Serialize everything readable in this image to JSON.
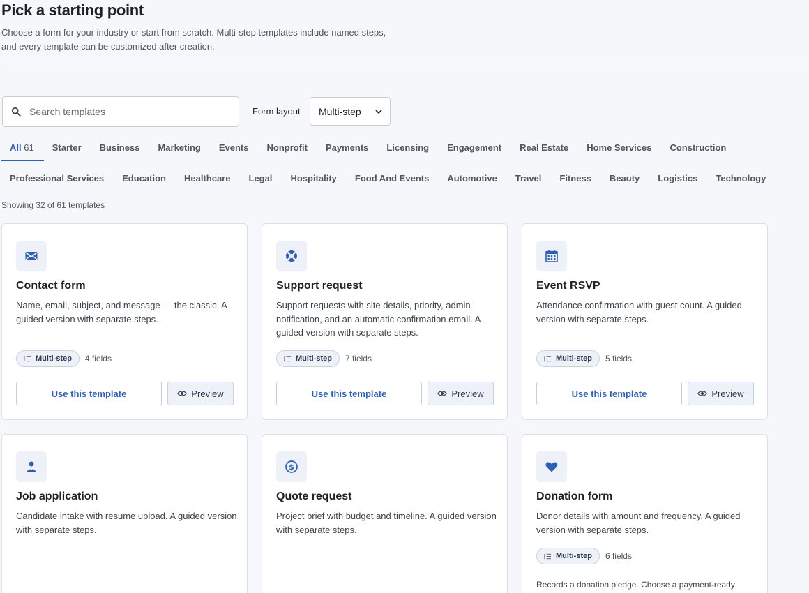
{
  "header": {
    "title": "Pick a starting point",
    "intro_line1": "Choose a form for your industry or start from scratch. Multi-step templates include named steps,",
    "intro_line2": "and every template can be customized after creation."
  },
  "search": {
    "placeholder": "Search templates",
    "value": "",
    "icon": "search-icon"
  },
  "layout": {
    "label": "Form layout",
    "selected": "Multi-step",
    "icon": "chevron-down-icon"
  },
  "tabs_row1": [
    {
      "label": "All",
      "count": "61",
      "active": true
    },
    {
      "label": "Starter"
    },
    {
      "label": "Business"
    },
    {
      "label": "Marketing"
    },
    {
      "label": "Events"
    },
    {
      "label": "Nonprofit"
    },
    {
      "label": "Payments"
    },
    {
      "label": "Licensing"
    },
    {
      "label": "Engagement"
    },
    {
      "label": "Real Estate"
    },
    {
      "label": "Home Services"
    },
    {
      "label": "Construction"
    }
  ],
  "tabs_row2": [
    {
      "label": "Professional Services"
    },
    {
      "label": "Education"
    },
    {
      "label": "Healthcare"
    },
    {
      "label": "Legal"
    },
    {
      "label": "Hospitality"
    },
    {
      "label": "Food And Events"
    },
    {
      "label": "Automotive"
    },
    {
      "label": "Travel"
    },
    {
      "label": "Fitness"
    },
    {
      "label": "Beauty"
    },
    {
      "label": "Logistics"
    },
    {
      "label": "Technology"
    }
  ],
  "showing": "Showing 32 of 61 templates",
  "colors": {
    "accent": "#2f5fb3",
    "badge_bg": "#eef2f8",
    "page_bg": "#f6f7fb"
  },
  "cards": [
    {
      "icon": "envelope-icon",
      "title": "Contact form",
      "desc": "Name, email, subject, and message — the classic. A guided version with separate steps.",
      "badge": "Multi-step",
      "fields": "4 fields",
      "use_label": "Use this template",
      "preview_label": "Preview"
    },
    {
      "icon": "lifebuoy-icon",
      "title": "Support request",
      "desc": "Support requests with site details, priority, admin notification, and an automatic confirmation email. A guided version with separate steps.",
      "badge": "Multi-step",
      "fields": "7 fields",
      "use_label": "Use this template",
      "preview_label": "Preview"
    },
    {
      "icon": "calendar-icon",
      "title": "Event RSVP",
      "desc": "Attendance confirmation with guest count. A guided version with separate steps.",
      "badge": "Multi-step",
      "fields": "5 fields",
      "use_label": "Use this template",
      "preview_label": "Preview"
    },
    {
      "icon": "person-icon",
      "title": "Job application",
      "desc": "Candidate intake with resume upload. A guided version with separate steps."
    },
    {
      "icon": "dollar-icon",
      "title": "Quote request",
      "desc": "Project brief with budget and timeline. A guided version with separate steps."
    },
    {
      "icon": "heart-icon",
      "title": "Donation form",
      "desc": "Donor details with amount and frequency. A guided version with separate steps.",
      "badge": "Multi-step",
      "fields": "6 fields",
      "note": "Records a donation pledge. Choose a payment-ready"
    }
  ]
}
